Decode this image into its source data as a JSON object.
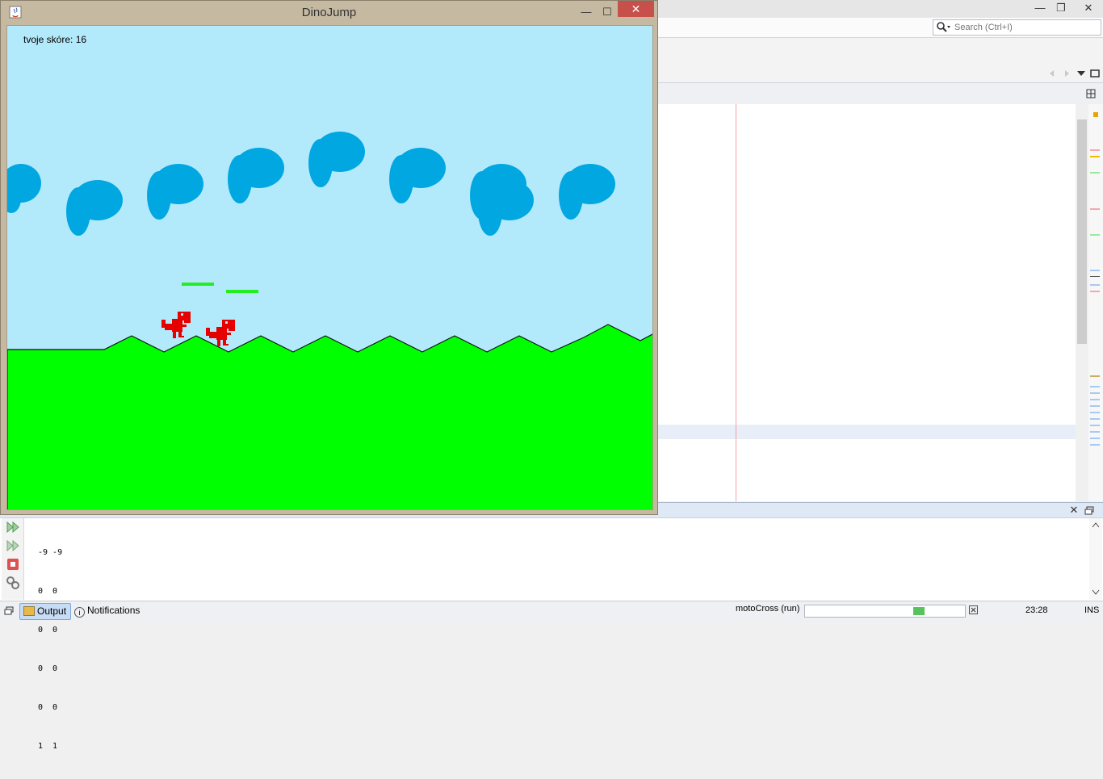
{
  "game_window": {
    "title": "DinoJump",
    "score_label": "tvoje skóre: 16",
    "colors": {
      "sky": "#b3eafb",
      "ground": "#00ff00",
      "cloud": "#00a7e1",
      "dino": "#e60000",
      "platform": "#22ee22"
    }
  },
  "ide": {
    "search_placeholder": "Search (Ctrl+I)",
    "output_lines": [
      "-9 -9",
      "0  0",
      "0  0",
      "0  0",
      "0  0",
      "1  1"
    ],
    "statusbar": {
      "output_tab": "Output",
      "notifications_tab": "Notifications",
      "run_status": "motoCross (run)",
      "time": "23:28",
      "insert_mode": "INS"
    }
  }
}
